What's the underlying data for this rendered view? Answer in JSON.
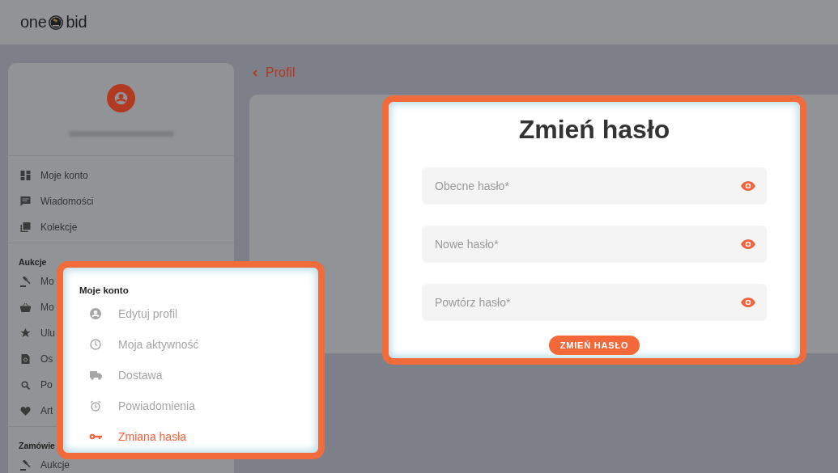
{
  "header": {
    "logo_left": "one",
    "logo_right": "bid"
  },
  "sidebar": {
    "nav": [
      {
        "label": "Moje konto"
      },
      {
        "label": "Wiadomości"
      },
      {
        "label": "Kolekcje"
      }
    ],
    "sections": [
      {
        "title": "Aukcje",
        "items": [
          {
            "label": "Mo"
          },
          {
            "label": "Mo"
          },
          {
            "label": "Ulu"
          },
          {
            "label": "Os"
          },
          {
            "label": "Po"
          },
          {
            "label": "Art"
          }
        ]
      },
      {
        "title": "Zamówie",
        "items": [
          {
            "label": "Aukcje"
          }
        ]
      }
    ]
  },
  "breadcrumb": {
    "label": "Profil"
  },
  "menu_callout": {
    "title": "Moje konto",
    "items": [
      {
        "label": "Edytuj profil",
        "selected": false
      },
      {
        "label": "Moja aktywność",
        "selected": false
      },
      {
        "label": "Dostawa",
        "selected": false
      },
      {
        "label": "Powiadomienia",
        "selected": false
      },
      {
        "label": "Zmiana hasła",
        "selected": true
      }
    ]
  },
  "password_callout": {
    "title": "Zmień hasło",
    "fields": [
      {
        "placeholder": "Obecne hasło*"
      },
      {
        "placeholder": "Nowe hasło*"
      },
      {
        "placeholder": "Powtórz hasło*"
      }
    ],
    "submit": "ZMIEŃ HASŁO"
  }
}
